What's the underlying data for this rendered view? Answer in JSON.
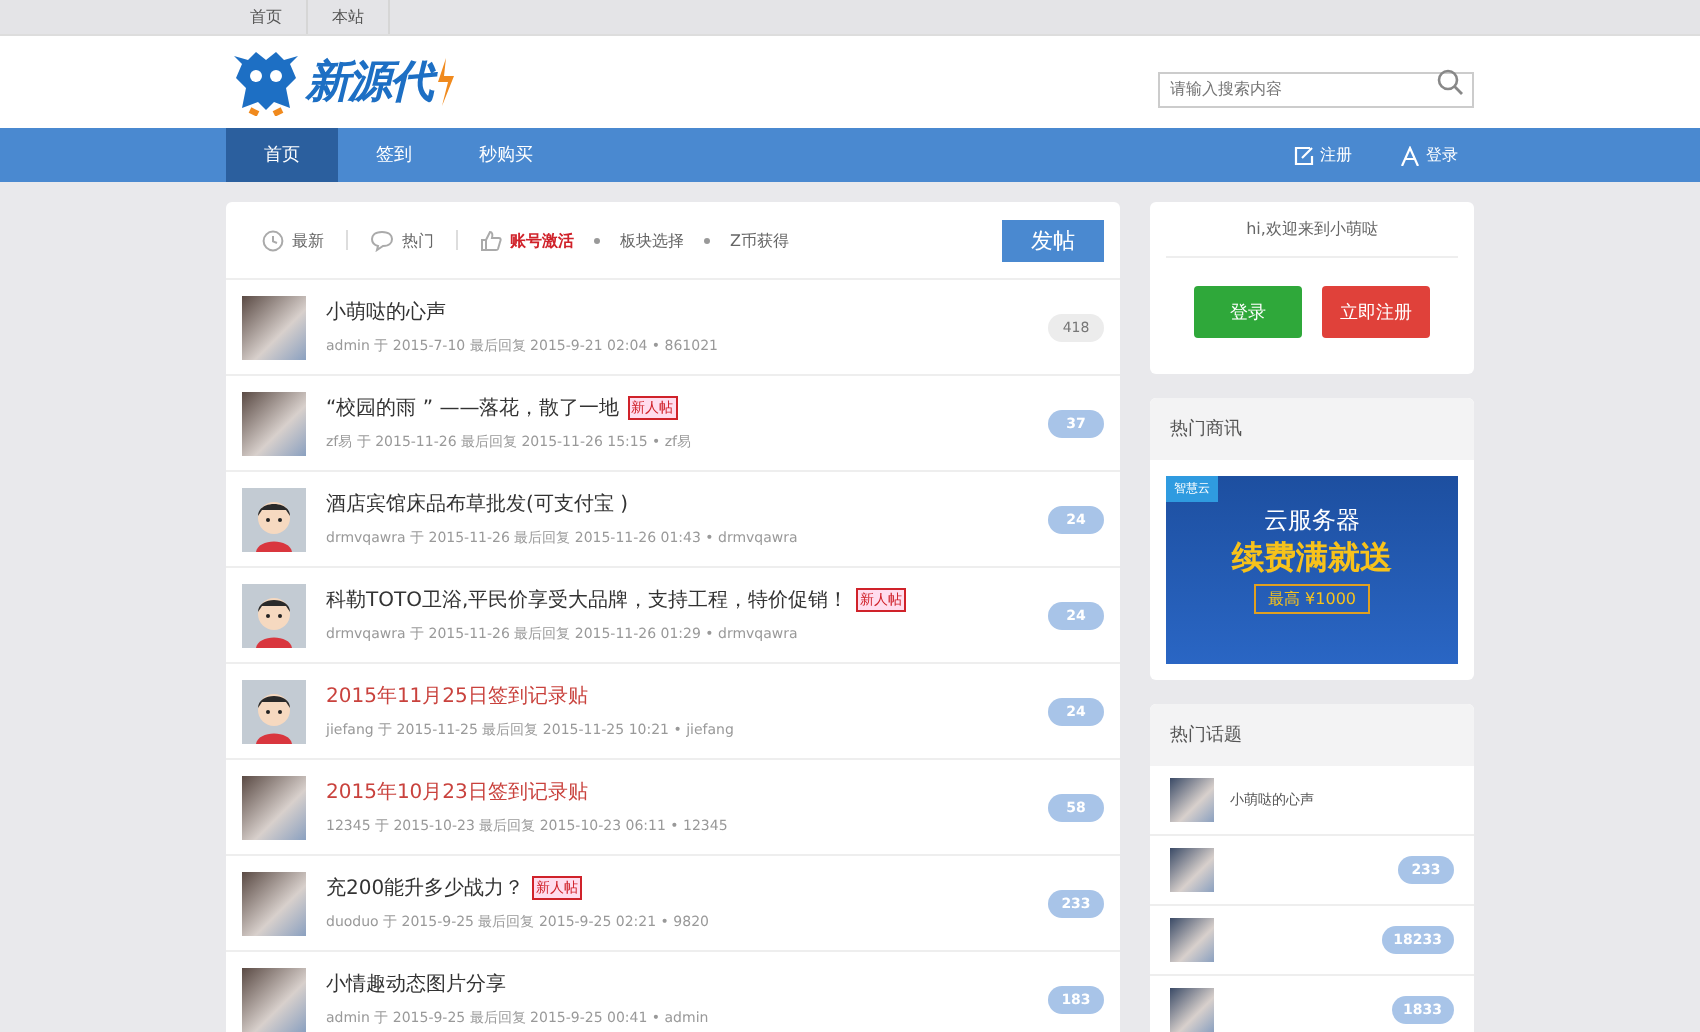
{
  "top_links": [
    "首页",
    "本站"
  ],
  "logo": {
    "text": "新源代"
  },
  "search": {
    "placeholder": "请输入搜索内容"
  },
  "nav": {
    "items": [
      {
        "label": "首页",
        "selected": true
      },
      {
        "label": "签到",
        "selected": false
      },
      {
        "label": "秒购买",
        "selected": false
      }
    ],
    "actions": [
      {
        "kind": "register",
        "label": "注册"
      },
      {
        "kind": "login",
        "label": "登录"
      }
    ]
  },
  "filters": [
    {
      "label": "最新",
      "selected": false
    },
    {
      "label": "热门",
      "selected": false
    },
    {
      "label": "账号激活",
      "selected": true
    },
    {
      "label": "板块选择",
      "selected": false
    },
    {
      "label": "Z币获得",
      "selected": false
    }
  ],
  "post_button": "发帖",
  "threads": [
    {
      "kind": "photo",
      "title": "小萌哒的心声",
      "highlight": false,
      "meta": "admin 于 2015-7-10 最后回复 2015-9-21 02:04 • 861021",
      "count": "418",
      "unread": false
    },
    {
      "kind": "photo",
      "title": "“校园的雨 ” ——落花，散了一地",
      "highlight": false,
      "tag": "新人帖",
      "meta": "zf易 于 2015-11-26 最后回复 2015-11-26 15:15 • zf易",
      "count": "37",
      "unread": true
    },
    {
      "kind": "cartoon",
      "title": "酒店宾馆床品布草批发(可支付宝 )",
      "highlight": false,
      "meta": "drmvqawra 于 2015-11-26 最后回复 2015-11-26 01:43 • drmvqawra",
      "count": "24",
      "unread": true
    },
    {
      "kind": "cartoon",
      "title": "科勒TOTO卫浴,平民价享受大品牌，支持工程，特价促销！",
      "highlight": false,
      "tag": "新人帖",
      "meta": "drmvqawra 于 2015-11-26 最后回复 2015-11-26 01:29 • drmvqawra",
      "count": "24",
      "unread": true
    },
    {
      "kind": "cartoon",
      "title": "2015年11月25日签到记录贴",
      "highlight": true,
      "meta": "jiefang 于 2015-11-25 最后回复 2015-11-25 10:21 • jiefang",
      "count": "24",
      "unread": true
    },
    {
      "kind": "photo",
      "title": "2015年10月23日签到记录贴",
      "highlight": true,
      "meta": "12345 于 2015-10-23 最后回复 2015-10-23 06:11 • 12345",
      "count": "58",
      "unread": true
    },
    {
      "kind": "photo",
      "title": "充200能升多少战力？",
      "highlight": false,
      "tag": "新人帖",
      "meta": "duoduo 于 2015-9-25 最后回复 2015-9-25 02:21 • 9820",
      "count": "233",
      "unread": true
    },
    {
      "kind": "photo",
      "title": "小情趣动态图片分享",
      "highlight": false,
      "meta": "admin 于 2015-9-25 最后回复 2015-9-25 00:41 • admin",
      "count": "183",
      "unread": true
    }
  ],
  "welcome": {
    "text": "hi,欢迎来到小萌哒",
    "buttons": [
      {
        "kind": "login",
        "label": "登录"
      },
      {
        "kind": "register",
        "label": "立即注册"
      }
    ]
  },
  "ads": {
    "title": "热门商讯",
    "banner": {
      "brand": "智慧云",
      "headline": "云服务器",
      "slogan": "续费满就送",
      "offer": "最高 ¥1000"
    }
  },
  "hot_topics": {
    "title": "热门话题",
    "items": [
      {
        "title": "小萌哒的心声"
      },
      {
        "count": "233"
      },
      {
        "count": "18233"
      },
      {
        "count": "1833"
      }
    ]
  }
}
